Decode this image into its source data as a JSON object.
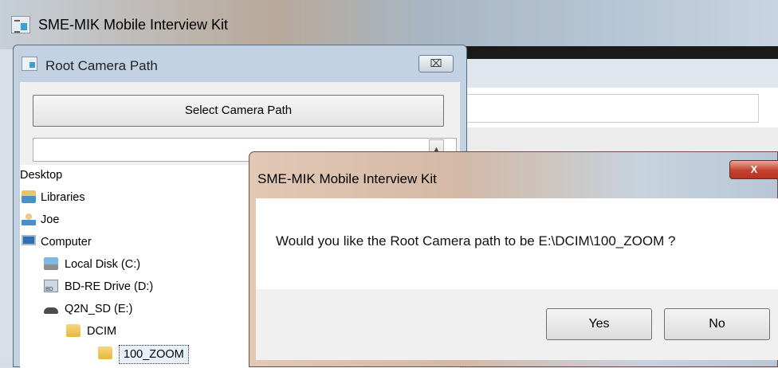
{
  "main_window": {
    "title": "SME-MIK Mobile Interview Kit"
  },
  "root_camera_dialog": {
    "title": "Root Camera Path",
    "close_glyph": "⌧",
    "select_button": "Select Camera Path",
    "path_value": "",
    "tree": {
      "items": [
        {
          "label": "Desktop",
          "icon": "none"
        },
        {
          "label": "Libraries",
          "icon": "libraries-icon"
        },
        {
          "label": "Joe",
          "icon": "user-icon"
        },
        {
          "label": "Computer",
          "icon": "computer-icon"
        },
        {
          "label": "Local Disk (C:)",
          "icon": "local-disk-icon"
        },
        {
          "label": "BD-RE Drive (D:)",
          "icon": "bd-drive-icon"
        },
        {
          "label": "Q2N_SD (E:)",
          "icon": "removable-drive-icon"
        },
        {
          "label": "DCIM",
          "icon": "folder-icon"
        },
        {
          "label": "100_ZOOM",
          "icon": "folder-icon",
          "selected": true
        }
      ]
    }
  },
  "message_box": {
    "title": "SME-MIK Mobile Interview Kit",
    "close_glyph": "X",
    "message": "Would you like the Root Camera path to be E:\\DCIM\\100_ZOOM ?",
    "buttons": {
      "yes": "Yes",
      "no": "No"
    }
  }
}
